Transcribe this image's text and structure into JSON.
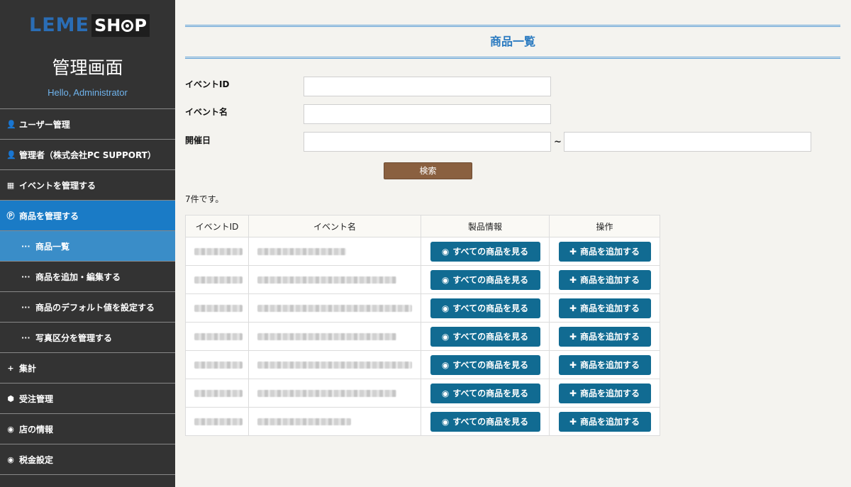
{
  "logo": {
    "part1": "LEME",
    "part2_a": "SH",
    "part2_b": "P"
  },
  "sidebar": {
    "title": "管理画面",
    "greeting": "Hello, Administrator",
    "items": [
      {
        "icon": "user-icon",
        "glyph": "👤",
        "label": "ユーザー管理"
      },
      {
        "icon": "user-icon",
        "glyph": "👤",
        "label": "管理者（株式会社PC SUPPORT）"
      },
      {
        "icon": "calendar-icon",
        "glyph": "▦",
        "label": "イベントを管理する"
      },
      {
        "icon": "product-icon",
        "glyph": "Ⓟ",
        "label": "商品を管理する"
      },
      {
        "icon": "dots-icon",
        "glyph": "···",
        "label": "商品一覧"
      },
      {
        "icon": "dots-icon",
        "glyph": "···",
        "label": "商品を追加・編集する"
      },
      {
        "icon": "dots-icon",
        "glyph": "···",
        "label": "商品のデフォルト値を設定する"
      },
      {
        "icon": "dots-icon",
        "glyph": "···",
        "label": "写真区分を管理する"
      },
      {
        "icon": "plus-icon",
        "glyph": "+",
        "label": "集計"
      },
      {
        "icon": "box-icon",
        "glyph": "⬢",
        "label": "受注管理"
      },
      {
        "icon": "account-icon",
        "glyph": "◉",
        "label": "店の情報"
      },
      {
        "icon": "account-icon",
        "glyph": "◉",
        "label": "税金設定"
      }
    ]
  },
  "page": {
    "title": "商品一覧"
  },
  "form": {
    "event_id_label": "イベントID",
    "event_name_label": "イベント名",
    "date_label": "開催日",
    "range_sep": "~",
    "search_label": "検索"
  },
  "result_count": "7件です。",
  "table": {
    "headers": [
      "イベントID",
      "イベント名",
      "製品情報",
      "操作"
    ],
    "view_label": "すべての商品を見る",
    "add_label": "商品を追加する",
    "rows": [
      {
        "id_w": 68,
        "name_w": 125
      },
      {
        "id_w": 68,
        "name_w": 196
      },
      {
        "id_w": 68,
        "name_w": 218
      },
      {
        "id_w": 68,
        "name_w": 196
      },
      {
        "id_w": 68,
        "name_w": 218
      },
      {
        "id_w": 68,
        "name_w": 196
      },
      {
        "id_w": 68,
        "name_w": 132
      }
    ]
  },
  "colors": {
    "sidebar_bg": "#333333",
    "active": "#1a7bc6",
    "sub_active": "#3a8dc8",
    "button_blue": "#116b92",
    "search_brown": "#8a6040",
    "title_blue": "#2a7ac0"
  }
}
